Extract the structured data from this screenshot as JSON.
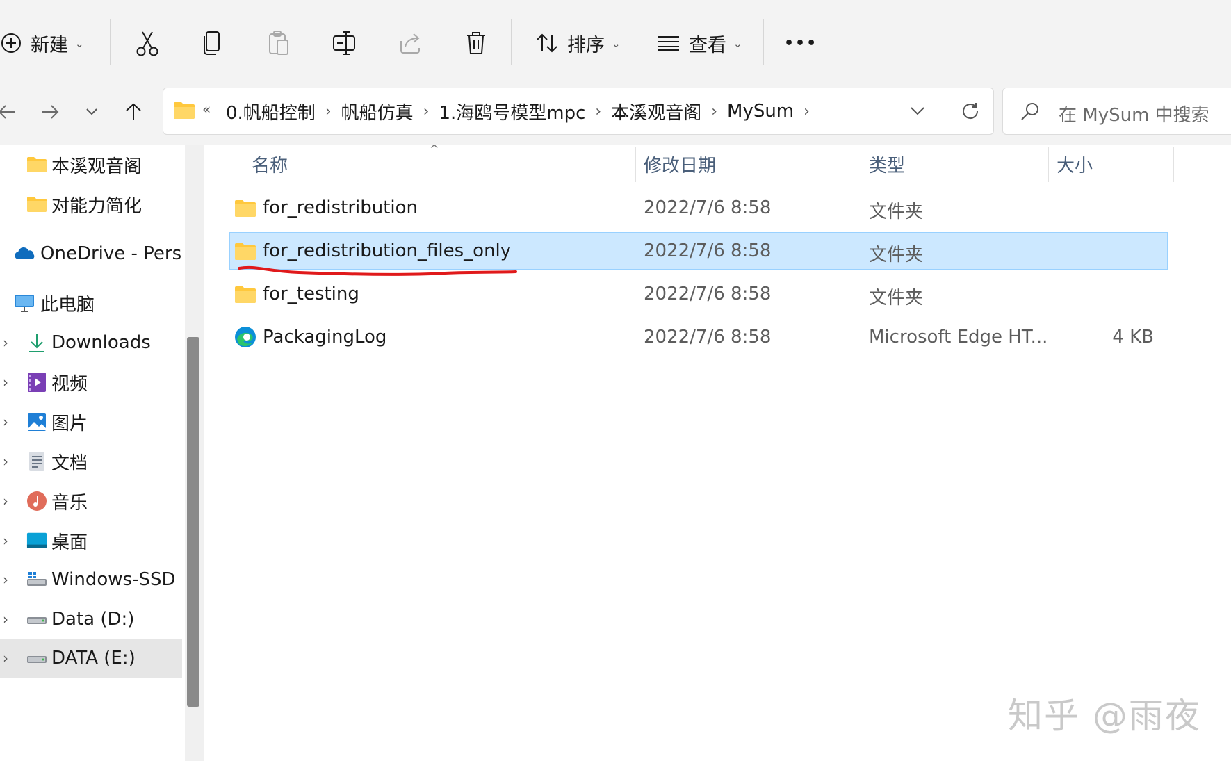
{
  "toolbar": {
    "new_label": "新建",
    "sort_label": "排序",
    "view_label": "查看",
    "more_label": "•••"
  },
  "breadcrumbs": {
    "overflow": "«",
    "items": [
      "0.帆船控制",
      "帆船仿真",
      "1.海鸥号模型mpc",
      "本溪观音阁",
      "MySum"
    ]
  },
  "search": {
    "placeholder": "在 MySum 中搜索"
  },
  "sidebar": {
    "items": [
      {
        "label": "本溪观音阁",
        "icon": "folder-icon"
      },
      {
        "label": "对能力简化",
        "icon": "folder-icon"
      },
      {
        "label": "OneDrive - Persor",
        "icon": "onedrive-icon"
      },
      {
        "label": "此电脑",
        "icon": "computer-icon"
      },
      {
        "label": "Downloads",
        "icon": "download-icon"
      },
      {
        "label": "视频",
        "icon": "videos-icon"
      },
      {
        "label": "图片",
        "icon": "pictures-icon"
      },
      {
        "label": "文档",
        "icon": "documents-icon"
      },
      {
        "label": "音乐",
        "icon": "music-icon"
      },
      {
        "label": "桌面",
        "icon": "desktop-icon"
      },
      {
        "label": "Windows-SSD (C",
        "icon": "drive-icon"
      },
      {
        "label": "Data (D:)",
        "icon": "drive-icon"
      },
      {
        "label": "DATA (E:)",
        "icon": "drive-icon"
      }
    ]
  },
  "columns": {
    "name": "名称",
    "modified": "修改日期",
    "type": "类型",
    "size": "大小"
  },
  "files": [
    {
      "name": "for_redistribution",
      "modified": "2022/7/6 8:58",
      "type": "文件夹",
      "size": "",
      "icon": "folder-icon"
    },
    {
      "name": "for_redistribution_files_only",
      "modified": "2022/7/6 8:58",
      "type": "文件夹",
      "size": "",
      "icon": "folder-icon",
      "selected": true
    },
    {
      "name": "for_testing",
      "modified": "2022/7/6 8:58",
      "type": "文件夹",
      "size": "",
      "icon": "folder-icon"
    },
    {
      "name": "PackagingLog",
      "modified": "2022/7/6 8:58",
      "type": "Microsoft Edge HT...",
      "size": "4 KB",
      "icon": "edge-icon"
    }
  ],
  "watermark": "知乎 @雨夜",
  "colors": {
    "selection": "#cce8ff",
    "selection_border": "#99d1ff",
    "annotation": "#e0191b",
    "folder": "#ffc83d"
  }
}
